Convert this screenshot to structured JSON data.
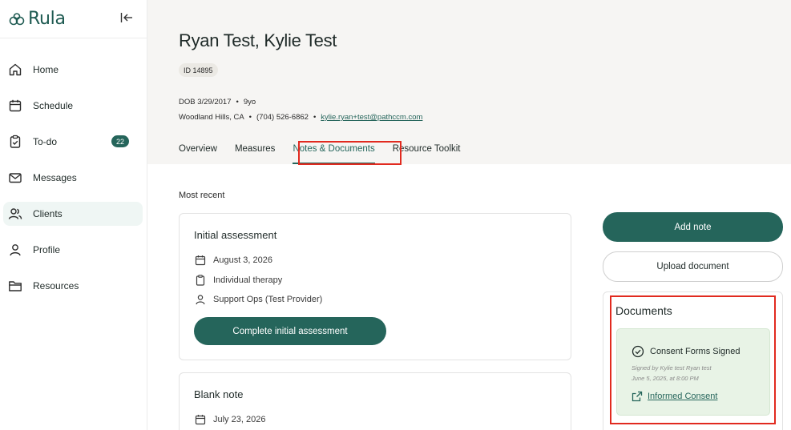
{
  "app": {
    "logo_text": "Rula",
    "brand_color": "#25655b"
  },
  "sidebar": {
    "items": [
      {
        "label": "Home",
        "icon": "home-icon"
      },
      {
        "label": "Schedule",
        "icon": "calendar-icon"
      },
      {
        "label": "To-do",
        "icon": "clipboard-check-icon",
        "badge": "22"
      },
      {
        "label": "Messages",
        "icon": "mail-icon"
      },
      {
        "label": "Clients",
        "icon": "users-icon",
        "active": true
      },
      {
        "label": "Profile",
        "icon": "user-icon"
      },
      {
        "label": "Resources",
        "icon": "folder-icon"
      }
    ]
  },
  "client": {
    "name": "Ryan Test, Kylie Test",
    "id_label": "ID 14895",
    "dob": "DOB 3/29/2017",
    "age": "9yo",
    "location": "Woodland Hills, CA",
    "phone": "(704) 526-6862",
    "email": "kylie.ryan+test@pathccm.com"
  },
  "tabs": [
    {
      "label": "Overview"
    },
    {
      "label": "Measures"
    },
    {
      "label": "Notes & Documents",
      "active": true
    },
    {
      "label": "Resource Toolkit"
    }
  ],
  "main": {
    "section_label": "Most recent",
    "notes": [
      {
        "title": "Initial assessment",
        "date": "August 3, 2026",
        "type": "Individual therapy",
        "provider": "Support Ops (Test Provider)",
        "action_label": "Complete initial assessment"
      },
      {
        "title": "Blank note",
        "date": "July 23, 2026"
      }
    ]
  },
  "actions": {
    "add_note": "Add note",
    "upload_document": "Upload document"
  },
  "documents": {
    "title": "Documents",
    "consent": {
      "status": "Consent Forms Signed",
      "signed_by": "Signed by Kylie test Ryan test",
      "signed_at": "June 5, 2025, at 8:00 PM",
      "link_label": "Informed Consent"
    }
  }
}
